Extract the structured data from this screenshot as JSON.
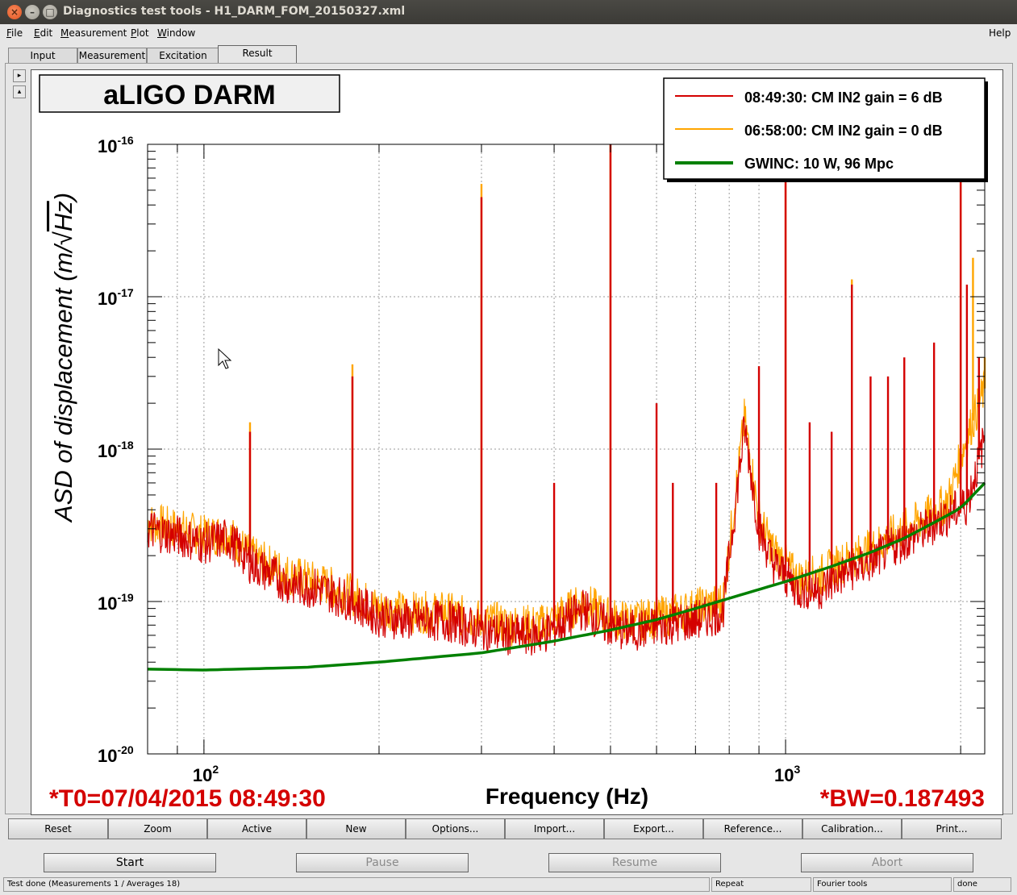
{
  "window": {
    "title": "Diagnostics test tools - H1_DARM_FOM_20150327.xml",
    "close_glyph": "×",
    "min_glyph": "–",
    "max_glyph": "□"
  },
  "menu": {
    "items": [
      {
        "underline": "F",
        "rest": "ile"
      },
      {
        "underline": "E",
        "rest": "dit"
      },
      {
        "underline": "M",
        "rest": "easurement"
      },
      {
        "underline": "P",
        "rest": "lot"
      },
      {
        "underline": "W",
        "rest": "indow"
      }
    ],
    "help": "Help"
  },
  "tabs": [
    {
      "label": "Input",
      "active": false
    },
    {
      "label": "Measurement",
      "active": false
    },
    {
      "label": "Excitation",
      "active": false
    },
    {
      "label": "Result",
      "active": true
    }
  ],
  "side_arrows": {
    "up": "▸",
    "down": "▴"
  },
  "chart_data": {
    "type": "line",
    "title": "aLIGO DARM",
    "xlabel": "Frequency (Hz)",
    "ylabel": "ASD of displacement (m/√Hz)",
    "ylabel_prefix": "ASD of displacement  (m/",
    "ylabel_root": "Hz",
    "ylabel_suffix": ")",
    "x_scale": "log",
    "y_scale": "log",
    "xlim": [
      80,
      2200
    ],
    "ylim": [
      1e-20,
      1e-16
    ],
    "grid": true,
    "legend_position": "top-right",
    "x_tick_labels": [
      {
        "base": "10",
        "exp": "2",
        "value": 100
      },
      {
        "base": "10",
        "exp": "3",
        "value": 1000
      }
    ],
    "y_tick_labels": [
      {
        "base": "10",
        "exp": "-16",
        "value": 1e-16
      },
      {
        "base": "10",
        "exp": "-17",
        "value": 1e-17
      },
      {
        "base": "10",
        "exp": "-18",
        "value": 1e-18
      },
      {
        "base": "10",
        "exp": "-19",
        "value": 1e-19
      },
      {
        "base": "10",
        "exp": "-20",
        "value": 1e-20
      }
    ],
    "series": [
      {
        "name": "08:49:30: CM IN2 gain = 6 dB",
        "color": "#d40000",
        "baseline": [
          [
            80,
            3e-19
          ],
          [
            90,
            2.7e-19
          ],
          [
            100,
            2.4e-19
          ],
          [
            110,
            2.6e-19
          ],
          [
            120,
            1.8e-19
          ],
          [
            140,
            1.3e-19
          ],
          [
            160,
            1.2e-19
          ],
          [
            180,
            1e-19
          ],
          [
            200,
            8e-20
          ],
          [
            230,
            7.5e-20
          ],
          [
            260,
            7.5e-20
          ],
          [
            300,
            6.5e-20
          ],
          [
            340,
            6e-20
          ],
          [
            380,
            6e-20
          ],
          [
            420,
            7.5e-20
          ],
          [
            450,
            9e-20
          ],
          [
            490,
            7e-20
          ],
          [
            520,
            6.5e-20
          ],
          [
            560,
            6.5e-20
          ],
          [
            620,
            7e-20
          ],
          [
            700,
            7.5e-20
          ],
          [
            780,
            8.5e-20
          ],
          [
            850,
            1.4e-18
          ],
          [
            900,
            3e-19
          ],
          [
            950,
            1.8e-19
          ],
          [
            1050,
            1.2e-19
          ],
          [
            1150,
            1.2e-19
          ],
          [
            1250,
            1.5e-19
          ],
          [
            1400,
            1.8e-19
          ],
          [
            1500,
            2.2e-19
          ],
          [
            1600,
            2.5e-19
          ],
          [
            1750,
            3e-19
          ],
          [
            1900,
            3.7e-19
          ],
          [
            2050,
            4.3e-19
          ],
          [
            2200,
            1.2e-18
          ]
        ],
        "peaks": [
          [
            120,
            1.3e-18
          ],
          [
            180,
            3e-18
          ],
          [
            300,
            4.5e-17
          ],
          [
            400,
            6e-19
          ],
          [
            500,
            1e-16
          ],
          [
            600,
            2e-18
          ],
          [
            640,
            6e-19
          ],
          [
            760,
            6e-19
          ],
          [
            900,
            3.5e-18
          ],
          [
            1000,
            1e-16
          ],
          [
            1100,
            1.5e-18
          ],
          [
            1200,
            1.3e-18
          ],
          [
            1300,
            1.2e-17
          ],
          [
            1400,
            3e-18
          ],
          [
            1500,
            3e-18
          ],
          [
            1600,
            4e-18
          ],
          [
            1800,
            5e-18
          ],
          [
            2000,
            1e-16
          ],
          [
            2050,
            1.2e-17
          ],
          [
            2150,
            4e-18
          ]
        ]
      },
      {
        "name": "06:58:00: CM IN2 gain = 0 dB",
        "color": "#ffa500",
        "baseline": [
          [
            80,
            3.3e-19
          ],
          [
            90,
            3e-19
          ],
          [
            100,
            2.7e-19
          ],
          [
            110,
            2.8e-19
          ],
          [
            120,
            2e-19
          ],
          [
            140,
            1.5e-19
          ],
          [
            160,
            1.3e-19
          ],
          [
            180,
            1.1e-19
          ],
          [
            200,
            9e-20
          ],
          [
            230,
            8.5e-20
          ],
          [
            260,
            8.5e-20
          ],
          [
            300,
            7.5e-20
          ],
          [
            340,
            7e-20
          ],
          [
            380,
            7e-20
          ],
          [
            420,
            8.5e-20
          ],
          [
            450,
            1e-19
          ],
          [
            490,
            8e-20
          ],
          [
            520,
            7.5e-20
          ],
          [
            560,
            7.5e-20
          ],
          [
            620,
            8e-20
          ],
          [
            700,
            9e-20
          ],
          [
            780,
            1e-19
          ],
          [
            850,
            1.6e-18
          ],
          [
            900,
            3.5e-19
          ],
          [
            950,
            2.2e-19
          ],
          [
            1050,
            1.4e-19
          ],
          [
            1150,
            1.5e-19
          ],
          [
            1250,
            1.8e-19
          ],
          [
            1400,
            2.2e-19
          ],
          [
            1500,
            2.6e-19
          ],
          [
            1600,
            3e-19
          ],
          [
            1750,
            3.6e-19
          ],
          [
            1900,
            4.5e-19
          ],
          [
            2050,
            1.2e-18
          ],
          [
            2200,
            2.5e-18
          ]
        ],
        "peaks": [
          [
            120,
            1.5e-18
          ],
          [
            180,
            3.6e-18
          ],
          [
            300,
            5.5e-17
          ],
          [
            500,
            1e-16
          ],
          [
            1000,
            1e-16
          ],
          [
            1300,
            1.3e-17
          ],
          [
            2000,
            1e-16
          ],
          [
            2100,
            1.8e-17
          ],
          [
            2200,
            4e-18
          ]
        ]
      },
      {
        "name": "GWINC: 10 W, 96 Mpc",
        "color": "#008000",
        "baseline": [
          [
            80,
            3.6e-20
          ],
          [
            100,
            3.55e-20
          ],
          [
            150,
            3.7e-20
          ],
          [
            200,
            4e-20
          ],
          [
            300,
            4.6e-20
          ],
          [
            400,
            5.5e-20
          ],
          [
            500,
            6.5e-20
          ],
          [
            600,
            7.6e-20
          ],
          [
            700,
            9e-20
          ],
          [
            800,
            1.05e-19
          ],
          [
            1000,
            1.35e-19
          ],
          [
            1200,
            1.7e-19
          ],
          [
            1400,
            2.1e-19
          ],
          [
            1600,
            2.6e-19
          ],
          [
            1800,
            3.3e-19
          ],
          [
            2000,
            4.1e-19
          ],
          [
            2200,
            6e-19
          ]
        ],
        "peaks": []
      }
    ],
    "annotations": {
      "t0": "*T0=07/04/2015 08:49:30",
      "bw": "*BW=0.187493"
    }
  },
  "plot_buttons": [
    "Reset",
    "Zoom",
    "Active",
    "New",
    "Options...",
    "Import...",
    "Export...",
    "Reference...",
    "Calibration...",
    "Print..."
  ],
  "action_buttons": [
    {
      "label": "Start",
      "enabled": true
    },
    {
      "label": "Pause",
      "enabled": false
    },
    {
      "label": "Resume",
      "enabled": false
    },
    {
      "label": "Abort",
      "enabled": false
    }
  ],
  "status": {
    "message": "Test done (Measurements 1 / Averages 18)",
    "mode": "Repeat",
    "tool": "Fourier tools",
    "state": "done"
  }
}
